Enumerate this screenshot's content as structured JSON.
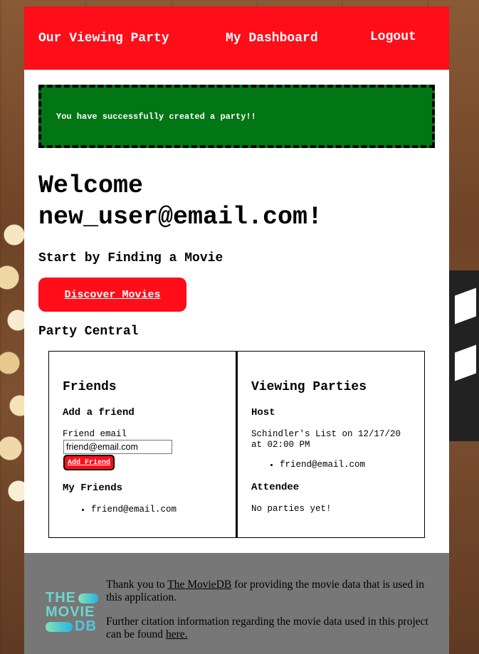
{
  "nav": {
    "home": "Our Viewing Party",
    "dashboard": "My Dashboard",
    "logout": "Logout"
  },
  "flash": "You have successfully created a party!!",
  "welcome": {
    "line1": "Welcome",
    "line2": "new_user@email.com!"
  },
  "start_heading": "Start by Finding a Movie",
  "discover_button": "Discover Movies",
  "party_heading": "Party Central",
  "friends": {
    "title": "Friends",
    "add_title": "Add a friend",
    "email_label": "Friend email",
    "email_value": "friend@email.com",
    "add_button": "Add Friend",
    "my_friends_title": "My Friends",
    "list": [
      "friend@email.com"
    ]
  },
  "parties": {
    "title": "Viewing Parties",
    "host_title": "Host",
    "host_party_line1": "Schindler's List on 12/17/20",
    "host_party_line2": "at 02:00 PM",
    "host_invitees": [
      "friend@email.com"
    ],
    "attendee_title": "Attendee",
    "attendee_empty": "No parties yet!"
  },
  "footer": {
    "logo": {
      "line1": "THE",
      "line2": "MOVIE",
      "line3": "DB"
    },
    "p1_pre": "Thank you to ",
    "p1_link": "The MovieDB",
    "p1_post": " for providing the movie data that is used in this application.",
    "p2_pre": "Further citation information regarding the movie data used in this project can be found ",
    "p2_link": "here."
  },
  "colors": {
    "accent_red": "#ff0d19",
    "flash_green": "#027514",
    "footer_gray": "#777777"
  }
}
